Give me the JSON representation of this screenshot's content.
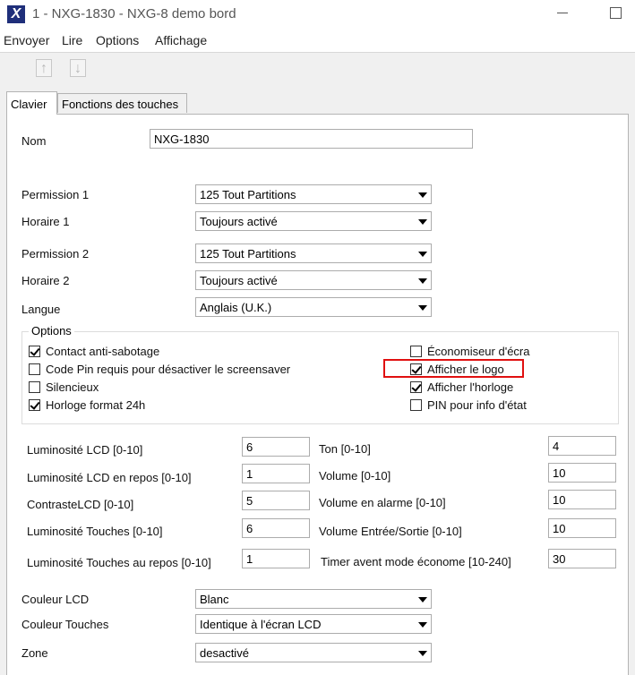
{
  "window": {
    "title": "1 - NXG-1830 - NXG-8 demo bord",
    "app_icon": "X"
  },
  "menu": [
    "Envoyer",
    "Lire",
    "Options",
    "Affichage"
  ],
  "toolbar": {
    "upload_icon": "upload-icon",
    "download_icon": "download-icon"
  },
  "tabs": [
    "Clavier",
    "Fonctions des touches"
  ],
  "form": {
    "nom_label": "Nom",
    "nom_value": "NXG-1830",
    "permission1_label": "Permission 1",
    "permission1_value": "125 Tout Partitions",
    "horaire1_label": "Horaire 1",
    "horaire1_value": "Toujours activé",
    "permission2_label": "Permission 2",
    "permission2_value": "125 Tout Partitions",
    "horaire2_label": "Horaire 2",
    "horaire2_value": "Toujours activé",
    "langue_label": "Langue",
    "langue_value": "Anglais (U.K.)"
  },
  "options": {
    "legend": "Options",
    "items": [
      {
        "label": "Contact anti-sabotage",
        "checked": true
      },
      {
        "label": "Code Pin requis pour désactiver le screensaver",
        "checked": false
      },
      {
        "label": "Silencieux",
        "checked": false
      },
      {
        "label": "Horloge format 24h",
        "checked": true
      },
      {
        "label": "Économiseur d'écra",
        "checked": false
      },
      {
        "label": "Afficher le logo",
        "checked": true
      },
      {
        "label": "Afficher l'horloge",
        "checked": true
      },
      {
        "label": "PIN pour info d'état",
        "checked": false
      }
    ]
  },
  "levels": {
    "lum_lcd_label": "Luminosité LCD [0-10]",
    "lum_lcd_value": "6",
    "lum_lcd_repos_label": "Luminosité LCD en repos [0-10]",
    "lum_lcd_repos_value": "1",
    "contraste_label": "ContrasteLCD [0-10]",
    "contraste_value": "5",
    "lum_touches_label": "Luminosité Touches [0-10]",
    "lum_touches_value": "6",
    "lum_touches_repos_label": "Luminosité Touches au repos [0-10]",
    "lum_touches_repos_value": "1",
    "ton_label": "Ton [0-10]",
    "ton_value": "4",
    "volume_label": "Volume [0-10]",
    "volume_value": "10",
    "volume_alarme_label": "Volume en alarme [0-10]",
    "volume_alarme_value": "10",
    "volume_es_label": "Volume Entrée/Sortie [0-10]",
    "volume_es_value": "10",
    "timer_label": "Timer avent mode économe [10-240]",
    "timer_value": "30"
  },
  "bottom": {
    "couleur_lcd_label": "Couleur LCD",
    "couleur_lcd_value": "Blanc",
    "couleur_touches_label": "Couleur Touches",
    "couleur_touches_value": "Identique à l'écran LCD",
    "zone_label": "Zone",
    "zone_value": "desactivé"
  }
}
